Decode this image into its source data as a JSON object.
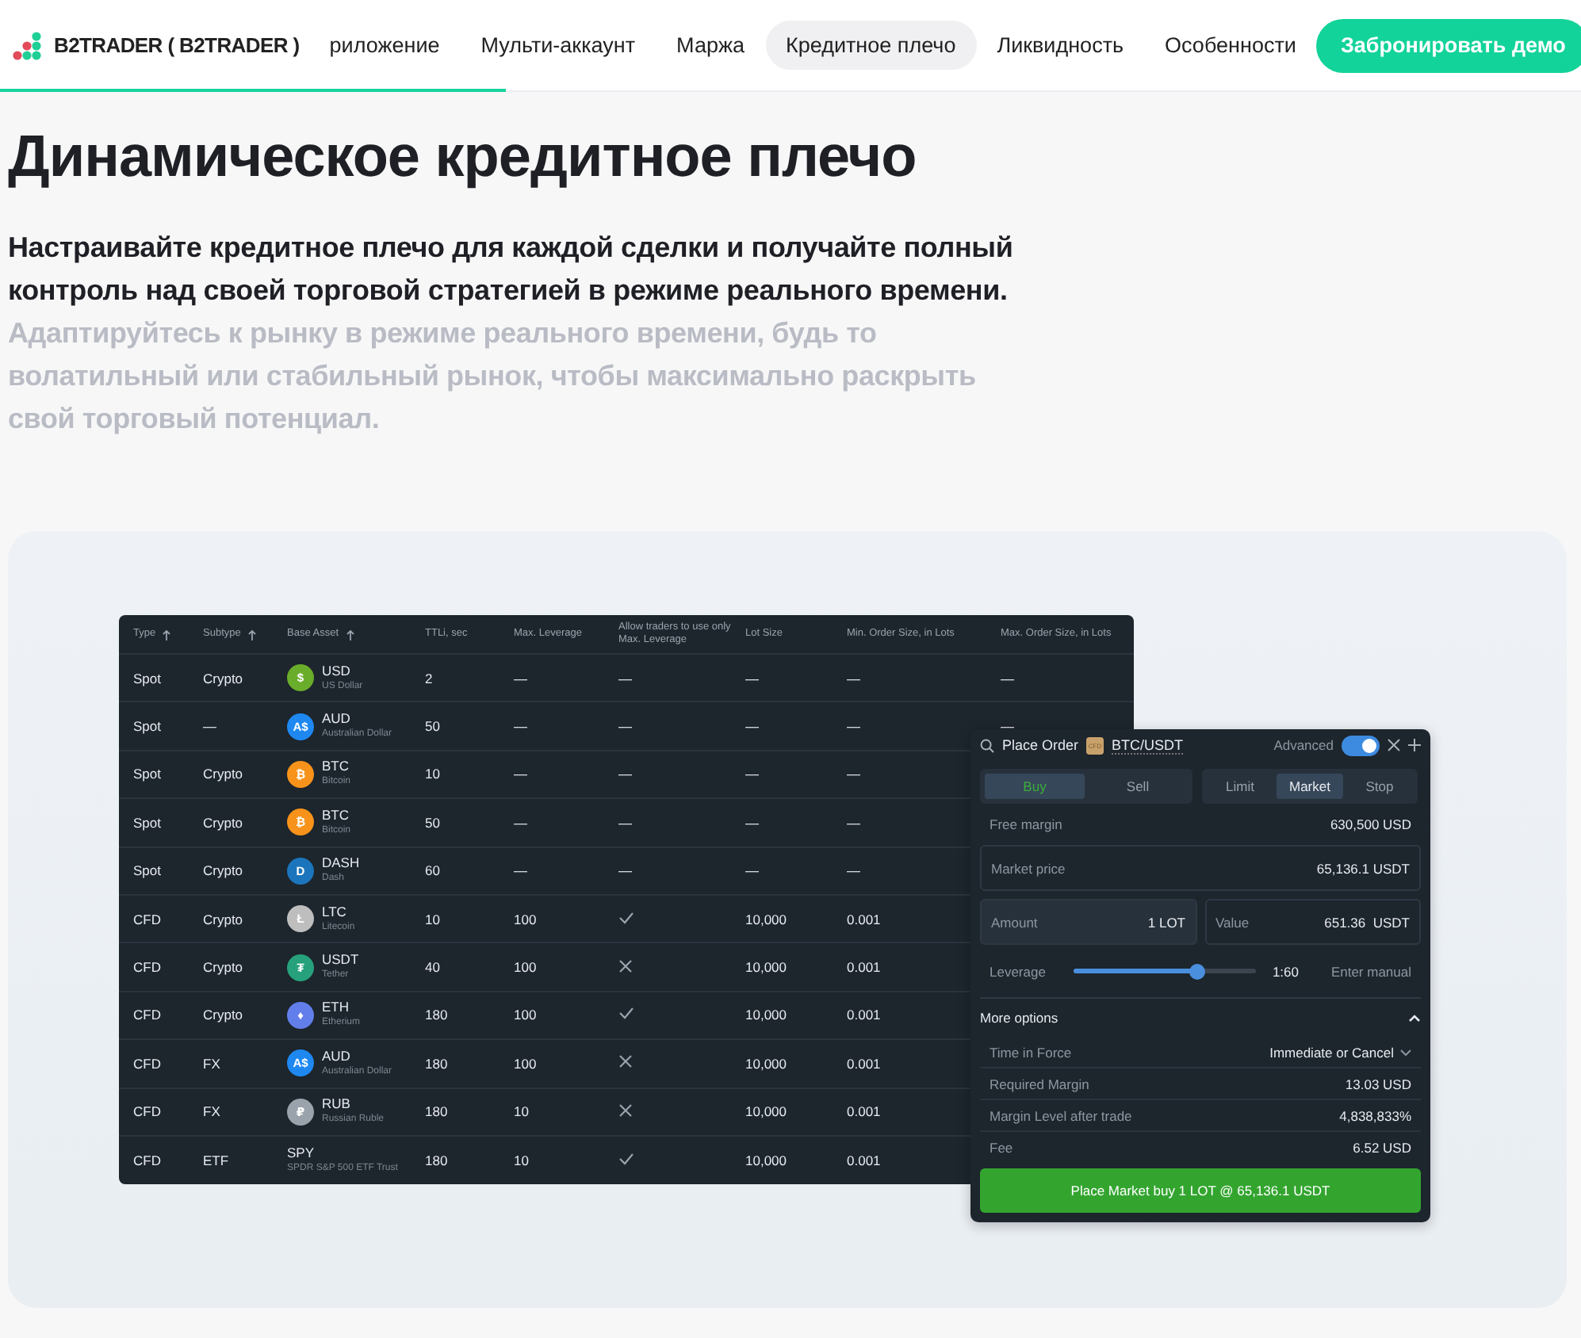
{
  "nav": {
    "brand": "B2TRADER ( B2TRADER )",
    "items": [
      {
        "label": "риложение",
        "selected": false
      },
      {
        "label": "Мульти-аккаунт",
        "selected": false
      },
      {
        "label": "Маржа",
        "selected": false
      },
      {
        "label": "Кредитное плечо",
        "selected": true
      },
      {
        "label": "Ликвидность",
        "selected": false
      },
      {
        "label": "Особенности",
        "selected": false
      }
    ],
    "cta": "Забронировать демо",
    "progress": {
      "level": 0.32
    }
  },
  "hero": {
    "title": "Динамическое кредитное плечо",
    "lead": "Настраивайте кредитное плечо для каждой сделки и получайте полный контроль над своей торговой стратегией в режиме реального времени.",
    "muted": "Адаптируйтесь к рынку в режиме реального времени, будь то волатильный или стабильный рынок, чтобы максимально раскрыть свой торговый потенциал."
  },
  "table": {
    "columns": [
      {
        "label": "Type",
        "sortable": true
      },
      {
        "label": "Subtype",
        "sortable": true
      },
      {
        "label": "Base Asset",
        "sortable": true
      },
      {
        "label": "TTLi, sec",
        "sortable": false
      },
      {
        "label": "Max. Leverage",
        "sortable": false
      },
      {
        "label": "Allow traders to use only Max. Leverage",
        "sortable": false
      },
      {
        "label": "Lot Size",
        "sortable": false
      },
      {
        "label": "Min. Order Size, in Lots",
        "sortable": false
      },
      {
        "label": "Max. Order Size, in Lots",
        "sortable": false
      }
    ],
    "rows": [
      {
        "type": "Spot",
        "subtype": "Crypto",
        "asset": {
          "code": "USD",
          "name": "US Dollar",
          "glyph": "$",
          "color": "#6aad2a"
        },
        "ttl": "2",
        "max_leverage": "—",
        "allow": {
          "kind": "text",
          "text": "—"
        },
        "lot_size": "—",
        "min_order": "—",
        "max_order": "—"
      },
      {
        "type": "Spot",
        "subtype": "—",
        "asset": {
          "code": "AUD",
          "name": "Australian Dollar",
          "glyph": "A$",
          "color": "#1e88f0"
        },
        "ttl": "50",
        "max_leverage": "—",
        "allow": {
          "kind": "text",
          "text": "—"
        },
        "lot_size": "—",
        "min_order": "—",
        "max_order": "—"
      },
      {
        "type": "Spot",
        "subtype": "Crypto",
        "asset": {
          "code": "BTC",
          "name": "Bitcoin",
          "glyph": "₿",
          "color": "#f7931a"
        },
        "ttl": "10",
        "max_leverage": "—",
        "allow": {
          "kind": "text",
          "text": "—"
        },
        "lot_size": "—",
        "min_order": "—"
      },
      {
        "type": "Spot",
        "subtype": "Crypto",
        "asset": {
          "code": "BTC",
          "name": "Bitcoin",
          "glyph": "₿",
          "color": "#f7931a"
        },
        "ttl": "50",
        "max_leverage": "—",
        "allow": {
          "kind": "text",
          "text": "—"
        },
        "lot_size": "—",
        "min_order": "—"
      },
      {
        "type": "Spot",
        "subtype": "Crypto",
        "asset": {
          "code": "DASH",
          "name": "Dash",
          "glyph": "D",
          "color": "#1c75bc"
        },
        "ttl": "60",
        "max_leverage": "—",
        "allow": {
          "kind": "text",
          "text": "—"
        },
        "lot_size": "—",
        "min_order": "—"
      },
      {
        "type": "CFD",
        "subtype": "Crypto",
        "asset": {
          "code": "LTC",
          "name": "Litecoin",
          "glyph": "Ł",
          "color": "#bebebe"
        },
        "ttl": "10",
        "max_leverage": "100",
        "allow": {
          "kind": "check"
        },
        "lot_size": "10,000",
        "min_order": "0.001"
      },
      {
        "type": "CFD",
        "subtype": "Crypto",
        "asset": {
          "code": "USDT",
          "name": "Tether",
          "glyph": "₮",
          "color": "#26a17b"
        },
        "ttl": "40",
        "max_leverage": "100",
        "allow": {
          "kind": "cross"
        },
        "lot_size": "10,000",
        "min_order": "0.001"
      },
      {
        "type": "CFD",
        "subtype": "Crypto",
        "asset": {
          "code": "ETH",
          "name": "Etherium",
          "glyph": "♦",
          "color": "#627eea"
        },
        "ttl": "180",
        "max_leverage": "100",
        "allow": {
          "kind": "check"
        },
        "lot_size": "10,000",
        "min_order": "0.001"
      },
      {
        "type": "CFD",
        "subtype": "FX",
        "asset": {
          "code": "AUD",
          "name": "Australian Dollar",
          "glyph": "A$",
          "color": "#1e88f0"
        },
        "ttl": "180",
        "max_leverage": "100",
        "allow": {
          "kind": "cross"
        },
        "lot_size": "10,000",
        "min_order": "0.001"
      },
      {
        "type": "CFD",
        "subtype": "FX",
        "asset": {
          "code": "RUB",
          "name": "Russian Ruble",
          "glyph": "₽",
          "color": "#9aa3ab"
        },
        "ttl": "180",
        "max_leverage": "10",
        "allow": {
          "kind": "cross"
        },
        "lot_size": "10,000",
        "min_order": "0.001"
      },
      {
        "type": "CFD",
        "subtype": "ETF",
        "asset": {
          "code": "SPY",
          "name": "SPDR S&P 500 ETF Trust"
        },
        "ttl": "180",
        "max_leverage": "10",
        "allow": {
          "kind": "check"
        },
        "lot_size": "10,000",
        "min_order": "0.001"
      }
    ]
  },
  "order": {
    "title": "Place Order",
    "instrument_badge": "CFD",
    "symbol": "BTC/USDT",
    "advanced": {
      "label": "Advanced",
      "on": true
    },
    "sides": [
      {
        "label": "Buy",
        "selected": true
      },
      {
        "label": "Sell",
        "selected": false
      }
    ],
    "types": [
      {
        "label": "Limit",
        "selected": false
      },
      {
        "label": "Market",
        "selected": true
      },
      {
        "label": "Stop",
        "selected": false
      }
    ],
    "free_margin": {
      "label": "Free margin",
      "value": "630,500 USD"
    },
    "market_price": {
      "label": "Market price",
      "value": "65,136.1 USDT"
    },
    "amount": {
      "label": "Amount",
      "value": "1 LOT"
    },
    "value": {
      "label": "Value",
      "value": "651.36  USDT"
    },
    "leverage": {
      "label": "Leverage",
      "level": 0.67,
      "reading": "1:60",
      "manual": "Enter manual"
    },
    "more_options": {
      "label": "More options",
      "expanded": true
    },
    "time_in_force": {
      "label": "Time in Force",
      "value": "Immediate or Cancel"
    },
    "details": [
      {
        "label": "Required Margin",
        "value": "13.03 USD"
      },
      {
        "label": "Margin Level after trade",
        "value": "4,838,833%"
      },
      {
        "label": "Fee",
        "value": "6.52 USD"
      }
    ],
    "submit": "Place Market buy 1 LOT @ 65,136.1 USDT"
  }
}
